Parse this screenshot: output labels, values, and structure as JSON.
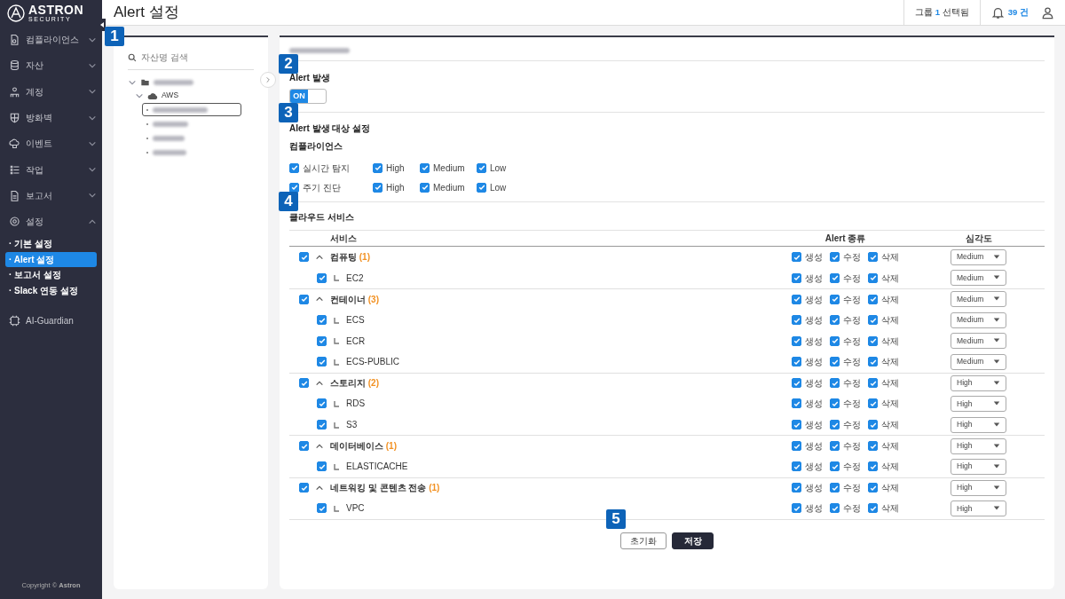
{
  "sidebar": {
    "logo": {
      "name": "ASTRON",
      "tagline": "SECURITY"
    },
    "menu": [
      {
        "label": "컴플라이언스",
        "expanded": false
      },
      {
        "label": "자산",
        "expanded": false
      },
      {
        "label": "계정",
        "expanded": false
      },
      {
        "label": "방화벽",
        "expanded": false
      },
      {
        "label": "이벤트",
        "expanded": false
      },
      {
        "label": "작업",
        "expanded": false
      },
      {
        "label": "보고서",
        "expanded": false
      },
      {
        "label": "설정",
        "expanded": true,
        "children": [
          {
            "label": "· 기본 설정",
            "selected": false
          },
          {
            "label": "· Alert 설정",
            "selected": true
          },
          {
            "label": "· 보고서 설정",
            "selected": false
          },
          {
            "label": "· Slack 연동 설정",
            "selected": false
          }
        ]
      }
    ],
    "extra": {
      "label": "AI-Guardian"
    },
    "copyright": "Copyright © **Astron**"
  },
  "header": {
    "title": "Alert 설정",
    "group_prefix": "그룹",
    "group_count": "1",
    "group_suffix": "선택됨",
    "notifications": "39 건"
  },
  "callouts": [
    "1",
    "2",
    "3",
    "4",
    "5"
  ],
  "tree": {
    "search": {
      "placeholder": "자산명 검색"
    },
    "nodes": [
      {
        "expanded": true,
        "children": [
          {
            "label": "AWS",
            "expanded": true,
            "children": [
              {
                "selected": true
              },
              {
                "selected": false
              },
              {
                "selected": false
              },
              {
                "selected": false
              }
            ]
          }
        ]
      }
    ]
  },
  "alert": {
    "title": "Alert 발생",
    "toggle": {
      "label": "ON",
      "on": true
    }
  },
  "targets": {
    "title": "Alert 발생 대상 설정",
    "subtitle": "컴플라이언스",
    "rows": [
      {
        "label": "실시간 탐지",
        "checked": true,
        "levels": [
          {
            "label": "High",
            "checked": true
          },
          {
            "label": "Medium",
            "checked": true
          },
          {
            "label": "Low",
            "checked": true
          }
        ]
      },
      {
        "label": "주기 진단",
        "checked": true,
        "levels": [
          {
            "label": "High",
            "checked": true
          },
          {
            "label": "Medium",
            "checked": true
          },
          {
            "label": "Low",
            "checked": true
          }
        ]
      }
    ]
  },
  "cloud": {
    "title": "클라우드 서비스",
    "columns": [
      "서비스",
      "Alert 종류",
      "심각도"
    ],
    "groups": [
      {
        "name": "컴퓨팅",
        "count": "(1)",
        "checked": true,
        "expanded": true,
        "alerts": [
          {
            "label": "생성",
            "checked": true
          },
          {
            "label": "수정",
            "checked": true
          },
          {
            "label": "삭제",
            "checked": true
          }
        ],
        "severity": "Medium",
        "children": [
          {
            "name": "EC2",
            "checked": true,
            "alerts": [
              {
                "label": "생성",
                "checked": true
              },
              {
                "label": "수정",
                "checked": true
              },
              {
                "label": "삭제",
                "checked": true
              }
            ],
            "severity": "Medium"
          }
        ]
      },
      {
        "name": "컨테이너",
        "count": "(3)",
        "checked": true,
        "expanded": true,
        "alerts": [
          {
            "label": "생성",
            "checked": true
          },
          {
            "label": "수정",
            "checked": true
          },
          {
            "label": "삭제",
            "checked": true
          }
        ],
        "severity": "Medium",
        "children": [
          {
            "name": "ECS",
            "checked": true,
            "alerts": [
              {
                "label": "생성",
                "checked": true
              },
              {
                "label": "수정",
                "checked": true
              },
              {
                "label": "삭제",
                "checked": true
              }
            ],
            "severity": "Medium"
          },
          {
            "name": "ECR",
            "checked": true,
            "alerts": [
              {
                "label": "생성",
                "checked": true
              },
              {
                "label": "수정",
                "checked": true
              },
              {
                "label": "삭제",
                "checked": true
              }
            ],
            "severity": "Medium"
          },
          {
            "name": "ECS-PUBLIC",
            "checked": true,
            "alerts": [
              {
                "label": "생성",
                "checked": true
              },
              {
                "label": "수정",
                "checked": true
              },
              {
                "label": "삭제",
                "checked": true
              }
            ],
            "severity": "Medium"
          }
        ]
      },
      {
        "name": "스토리지",
        "count": "(2)",
        "checked": true,
        "expanded": true,
        "alerts": [
          {
            "label": "생성",
            "checked": true
          },
          {
            "label": "수정",
            "checked": true
          },
          {
            "label": "삭제",
            "checked": true
          }
        ],
        "severity": "High",
        "children": [
          {
            "name": "RDS",
            "checked": true,
            "alerts": [
              {
                "label": "생성",
                "checked": true
              },
              {
                "label": "수정",
                "checked": true
              },
              {
                "label": "삭제",
                "checked": true
              }
            ],
            "severity": "High"
          },
          {
            "name": "S3",
            "checked": true,
            "alerts": [
              {
                "label": "생성",
                "checked": true
              },
              {
                "label": "수정",
                "checked": true
              },
              {
                "label": "삭제",
                "checked": true
              }
            ],
            "severity": "High"
          }
        ]
      },
      {
        "name": "데이터베이스",
        "count": "(1)",
        "checked": true,
        "expanded": true,
        "alerts": [
          {
            "label": "생성",
            "checked": true
          },
          {
            "label": "수정",
            "checked": true
          },
          {
            "label": "삭제",
            "checked": true
          }
        ],
        "severity": "High",
        "children": [
          {
            "name": "ELASTICACHE",
            "checked": true,
            "alerts": [
              {
                "label": "생성",
                "checked": true
              },
              {
                "label": "수정",
                "checked": true
              },
              {
                "label": "삭제",
                "checked": true
              }
            ],
            "severity": "High"
          }
        ]
      },
      {
        "name": "네트워킹 및 콘텐츠 전송",
        "count": "(1)",
        "checked": true,
        "expanded": true,
        "alerts": [
          {
            "label": "생성",
            "checked": true
          },
          {
            "label": "수정",
            "checked": true
          },
          {
            "label": "삭제",
            "checked": true
          }
        ],
        "severity": "High",
        "children": [
          {
            "name": "VPC",
            "checked": true,
            "alerts": [
              {
                "label": "생성",
                "checked": true
              },
              {
                "label": "수정",
                "checked": true
              },
              {
                "label": "삭제",
                "checked": true
              }
            ],
            "severity": "High"
          }
        ]
      }
    ]
  },
  "buttons": [
    {
      "label": "초기화",
      "kind": "secondary"
    },
    {
      "label": "저장",
      "kind": "primary"
    }
  ]
}
